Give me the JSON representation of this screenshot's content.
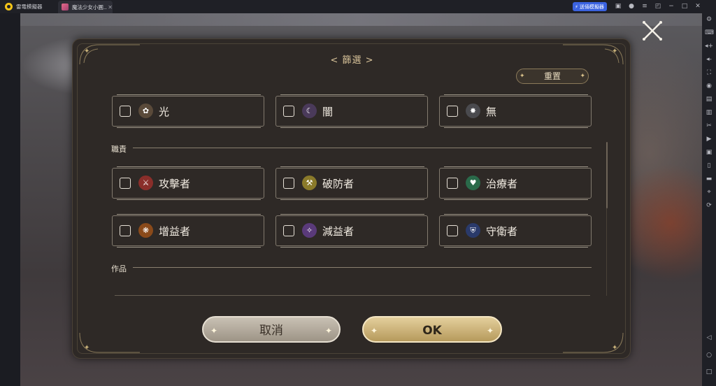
{
  "titlebar": {
    "app_name": "雷電模擬器",
    "tab_label": "魔法少女小圓...",
    "tab_close": "✕",
    "promo_label": "送倆模擬器",
    "icons": [
      "gamepad-icon",
      "user-icon",
      "menu-icon",
      "collapse-icon",
      "minimize-icon",
      "maximize-icon",
      "close-icon"
    ]
  },
  "sidebar": {
    "icons": [
      "settings-icon",
      "keyboard-icon",
      "volume-up-icon",
      "volume-down-icon",
      "fullscreen-icon",
      "location-icon",
      "install-apk-icon",
      "multi-instance-icon",
      "scissors-icon",
      "record-icon",
      "screenshot-icon",
      "phone-icon",
      "folder-icon",
      "gps-icon",
      "sync-icon",
      "back-icon",
      "home-icon",
      "recents-icon"
    ]
  },
  "dialog": {
    "title": "< 篩選 >",
    "reset_label": "重置",
    "element_options": [
      {
        "label": "光",
        "icon": "light-element-icon",
        "color": "#5a4a3a"
      },
      {
        "label": "闇",
        "icon": "dark-element-icon",
        "color": "#4a3a5a"
      },
      {
        "label": "無",
        "icon": "void-element-icon",
        "color": "#4a4a4e"
      }
    ],
    "role_section": "職責",
    "role_options": [
      {
        "label": "攻擊者",
        "icon": "attacker-icon",
        "color": "#8a2e2a"
      },
      {
        "label": "破防者",
        "icon": "breaker-icon",
        "color": "#8a7a2a"
      },
      {
        "label": "治療者",
        "icon": "healer-icon",
        "color": "#2a6a4a"
      },
      {
        "label": "增益者",
        "icon": "buffer-icon",
        "color": "#8a4a1a"
      },
      {
        "label": "減益者",
        "icon": "debuffer-icon",
        "color": "#5a3a7a"
      },
      {
        "label": "守衛者",
        "icon": "defender-icon",
        "color": "#2a3a6a"
      }
    ],
    "works_section": "作品",
    "cancel_label": "取消",
    "ok_label": "OK"
  },
  "colors": {
    "dialog_bg": "#2e2926",
    "accent_gold": "#d9c49a",
    "promo_blue": "#3b63e0"
  }
}
